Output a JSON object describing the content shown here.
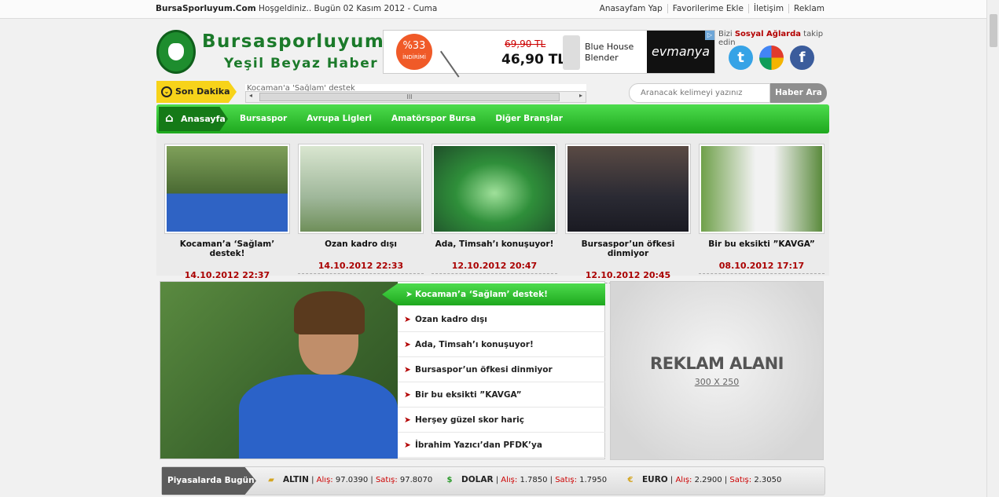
{
  "topbar": {
    "site": "BursaSporluyum.Com",
    "welcome": "Hoşgeldiniz.. Bugün 02 Kasım 2012 - Cuma",
    "links": [
      "Anasayfam Yap",
      "Favorilerime Ekle",
      "İletişim",
      "Reklam"
    ]
  },
  "logo": {
    "line1": "Bursasporluyum",
    "line2": "Yeşil Beyaz Haber"
  },
  "ad_banner": {
    "discount": "%33",
    "discount_sub": "İNDİRİMİ",
    "old_price": "69,90 TL",
    "new_price": "46,90 TL",
    "product": "Blue House Blender",
    "brand": "evmanya"
  },
  "social": {
    "prefix": "Bizi ",
    "highlight": "Sosyal Ağlarda",
    "suffix": " takip edin",
    "icons": [
      "twitter-icon",
      "google-icon",
      "facebook-icon"
    ]
  },
  "ticker": {
    "label": "Son Dakika",
    "text": "Kocaman'a 'Sağlam' destek",
    "scroll_grip": "III"
  },
  "search": {
    "placeholder": "Aranacak kelimeyi yazınız",
    "button": "Haber Ara"
  },
  "nav": {
    "home": "Anasayfa",
    "items": [
      "Bursaspor",
      "Avrupa Ligleri",
      "Amatörspor Bursa",
      "Diğer Branşlar"
    ]
  },
  "featured": [
    {
      "title": "Kocaman’a ‘Sağlam’ destek!",
      "date": "14.10.2012 22:37"
    },
    {
      "title": "Ozan kadro dışı",
      "date": "14.10.2012 22:33"
    },
    {
      "title": "Ada, Timsah’ı konuşuyor!",
      "date": "12.10.2012 20:47"
    },
    {
      "title": "Bursaspor’un öfkesi dinmiyor",
      "date": "12.10.2012 20:45"
    },
    {
      "title": "Bir bu eksikti ”KAVGA”",
      "date": "08.10.2012 17:17"
    }
  ],
  "slider_list": [
    "Kocaman’a ‘Sağlam’ destek!",
    "Ozan kadro dışı",
    "Ada, Timsah’ı konuşuyor!",
    "Bursaspor’un öfkesi dinmiyor",
    "Bir bu eksikti ”KAVGA”",
    "Herşey güzel skor hariç",
    "İbrahim Yazıcı’dan PFDK’ya bombardıman"
  ],
  "adbox": {
    "label": "REKLAM ALANI",
    "size": "300 X 250"
  },
  "market": {
    "label": "Piyasalarda Bugün",
    "rates": [
      {
        "name": "ALTIN",
        "buy_label": "Alış:",
        "buy": "97.0390",
        "sell_label": "Satış:",
        "sell": "97.8070"
      },
      {
        "name": "DOLAR",
        "buy_label": "Alış:",
        "buy": "1.7850",
        "sell_label": "Satış:",
        "sell": "1.7950"
      },
      {
        "name": "EURO",
        "buy_label": "Alış:",
        "buy": "2.2900",
        "sell_label": "Satış:",
        "sell": "2.3050"
      }
    ]
  }
}
